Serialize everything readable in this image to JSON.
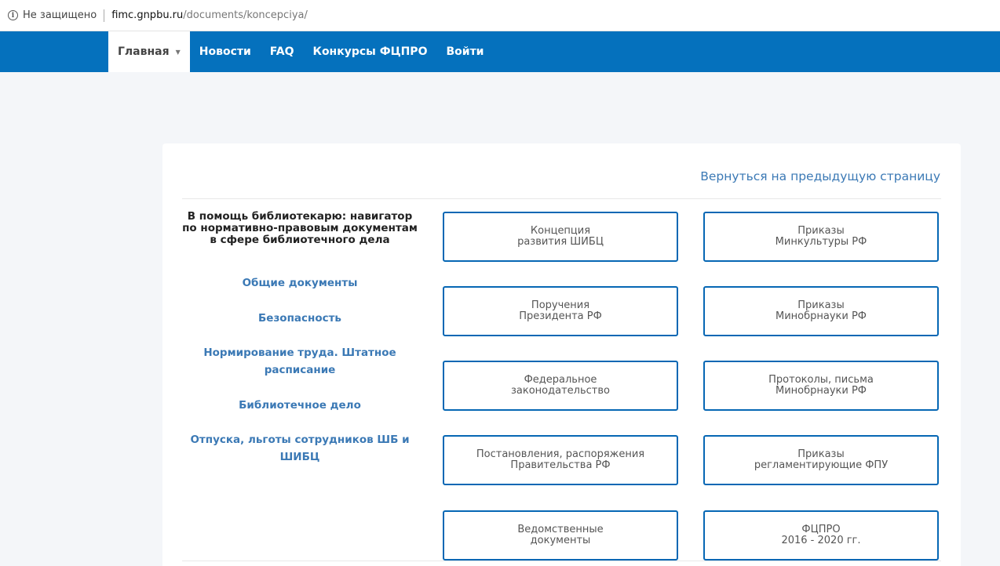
{
  "browser": {
    "security_text": "Не защищено",
    "url_host": "fimc.gnpbu.ru",
    "url_path": "/documents/koncepciya/"
  },
  "nav": {
    "items": [
      {
        "label": "Главная",
        "active": true,
        "dropdown": true
      },
      {
        "label": "Новости"
      },
      {
        "label": "FAQ"
      },
      {
        "label": "Конкурсы ФЦПРО"
      },
      {
        "label": "Войти"
      }
    ]
  },
  "content": {
    "back_link": "Вернуться на предыдущую страницу",
    "sidebar_title": "В помощь библиотекарю: навигатор по нормативно-правовым документам в сфере библиотечного дела",
    "sidebar_links": [
      "Общие документы",
      "Безопасность",
      "Нормирование труда. Штатное расписание",
      "Библиотечное дело",
      "Отпуска,  льготы сотрудников ШБ и ШИБЦ"
    ],
    "buttons": [
      [
        "Концепция\nразвития ШИБЦ",
        "Приказы\nМинкультуры РФ"
      ],
      [
        "Поручения\nПрезидента РФ",
        "Приказы\nМинобрнауки РФ"
      ],
      [
        "Федеральное\nзаконодательство",
        "Протоколы, письма\nМинобрнауки РФ"
      ],
      [
        "Постановления, распоряжения\nПравительства РФ",
        "Приказы\nрегламентирующие ФПУ"
      ],
      [
        "Ведомственные\nдокументы",
        "ФЦПРО\n2016 - 2020 гг."
      ]
    ]
  }
}
